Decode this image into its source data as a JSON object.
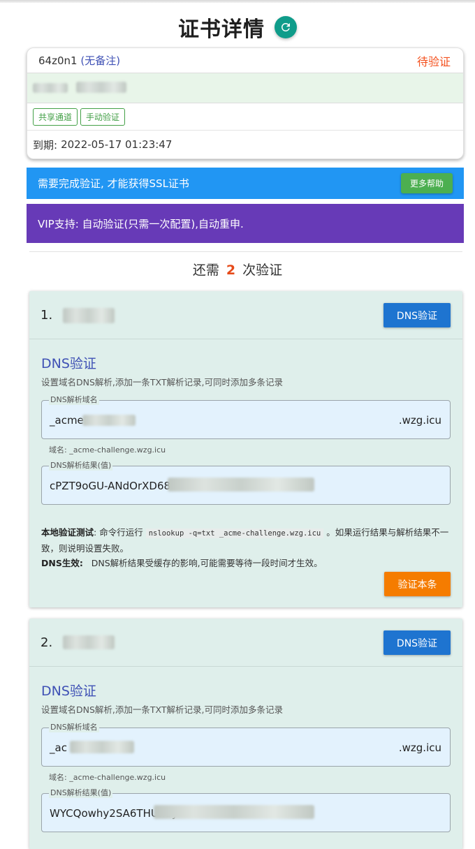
{
  "page": {
    "title": "证书详情"
  },
  "certificate": {
    "id": "64z0n1",
    "note": "(无备注)",
    "status": "待验证",
    "tags": [
      "共享通道",
      "手动验证"
    ],
    "expire_label": "到期:",
    "expire_time": "2022-05-17 01:23:47"
  },
  "alerts": {
    "info_text": "需要完成验证, 才能获得SSL证书",
    "help_button": "更多帮助",
    "vip_text": "VIP支持: 自动验证(只需一次配置),自动重申."
  },
  "remaining": {
    "prefix": "还需",
    "count": "2",
    "suffix": "次验证"
  },
  "verifications": [
    {
      "number": "1.",
      "method_button": "DNS验证",
      "section_title": "DNS验证",
      "description": "设置域名DNS解析,添加一条TXT解析记录,可同时添加多条记录",
      "host_label": "DNS解析域名",
      "host_value": "_acme",
      "host_suffix": ".wzg.icu",
      "host_hint": "域名: _acme-challenge.wzg.icu",
      "value_label": "DNS解析结果(值)",
      "value_text": "cPZT9oGU-ANdOrXD68",
      "local_test_label": "本地验证测试",
      "local_test_prefix": ": 命令行运行",
      "local_test_code": "nslookup -q=txt _acme-challenge.wzg.icu",
      "local_test_suffix": "。如果运行结果与解析结果不一致，则说明设置失败。",
      "effect_label": "DNS生效:",
      "effect_text": "DNS解析结果受缓存的影响,可能需要等待一段时间才生效。",
      "verify_button": "验证本条"
    },
    {
      "number": "2.",
      "method_button": "DNS验证",
      "section_title": "DNS验证",
      "description": "设置域名DNS解析,添加一条TXT解析记录,可同时添加多条记录",
      "host_label": "DNS解析域名",
      "host_value": "_ac",
      "host_suffix": ".wzg.icu",
      "host_hint": "域名: _acme-challenge.wzg.icu",
      "value_label": "DNS解析结果(值)",
      "value_text": "WYCQowhy2SA6THUnSy"
    }
  ],
  "colors": {
    "status": "#f4511e",
    "info": "#2196f3",
    "vip": "#673ab7",
    "primary_button": "#1e74d0",
    "verify_button": "#f57c00",
    "tag": "#43a047"
  },
  "icons": {
    "refresh": "refresh-icon"
  }
}
